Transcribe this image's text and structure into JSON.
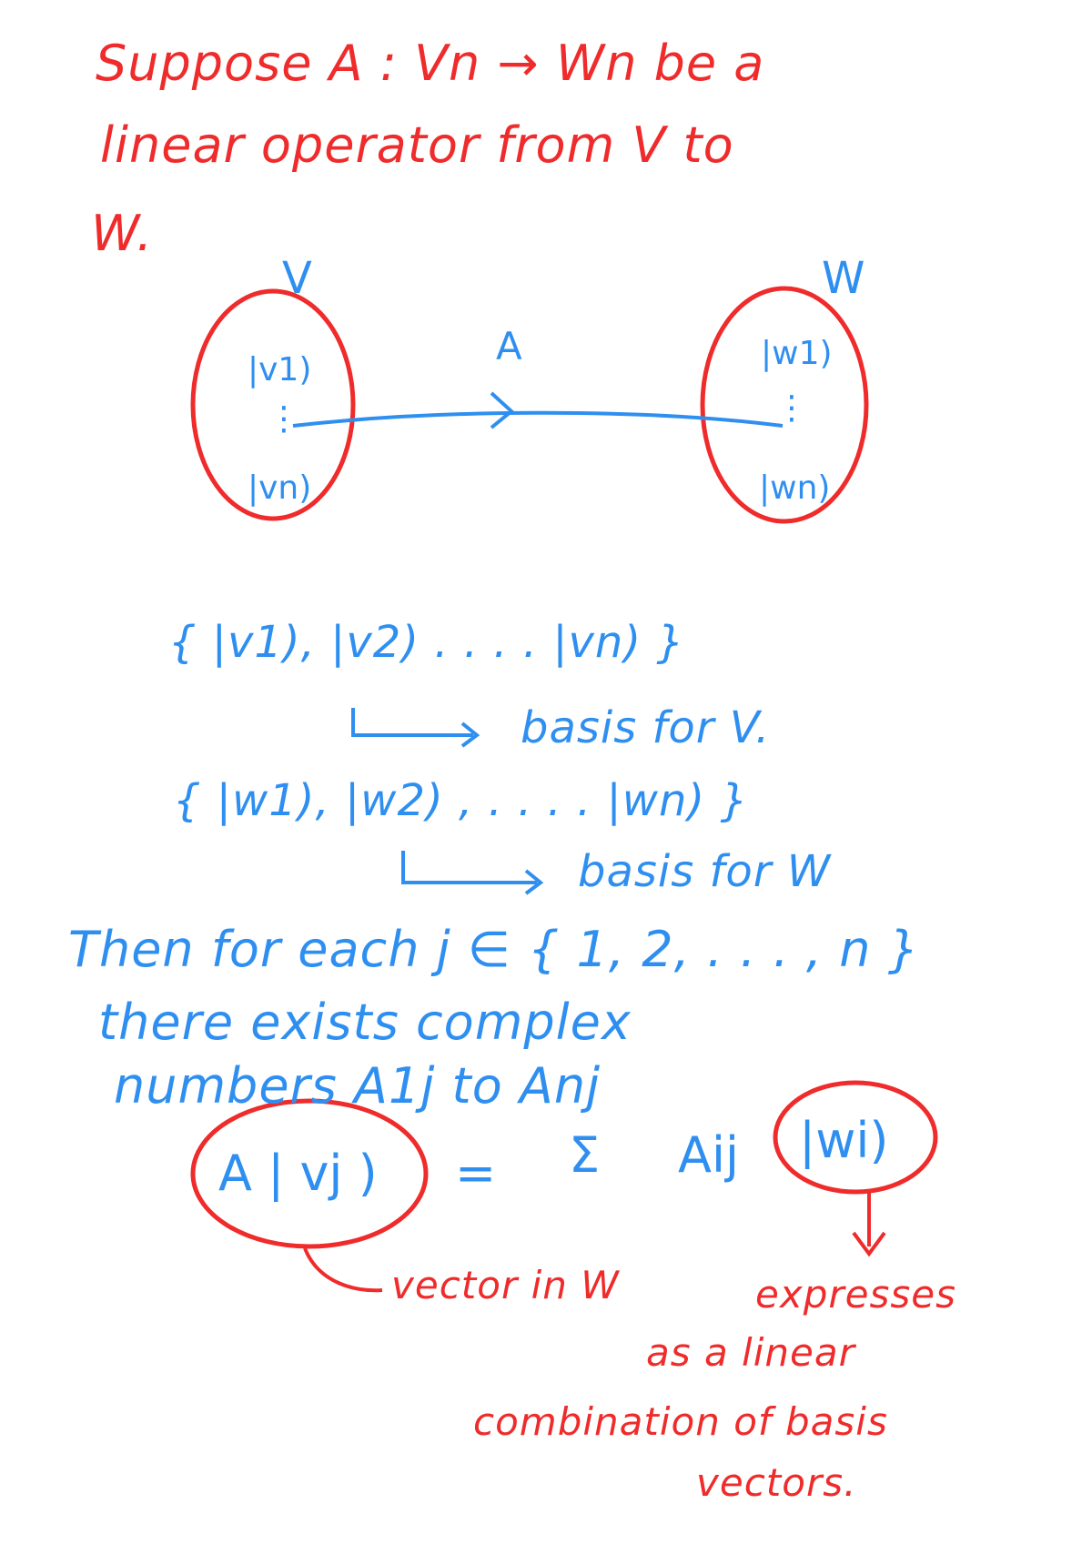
{
  "colors": {
    "red": "#ef2b2b",
    "blue": "#2f8ff0"
  },
  "intro": {
    "line1": "Suppose  A : Vn → Wn  be a",
    "line2": "linear operator from V to",
    "line3": "W."
  },
  "diagram": {
    "label_v": "V",
    "label_w": "W",
    "label_a": "A",
    "v_top": "|v1)",
    "v_dots": "⋮",
    "v_bottom": "|vn)",
    "w_top": "|w1)",
    "w_dots": "⋮",
    "w_bottom": "|wn)"
  },
  "basis_v": {
    "set": "{ |v1), |v2) . . . . |vn) }",
    "label": "basis for V."
  },
  "basis_w": {
    "set": "{ |w1), |w2) , . . . . |wn) }",
    "label": "basis for W"
  },
  "statement": {
    "line1": "Then for each  j ∈ { 1, 2, . . . , n }",
    "line2": "there exists complex",
    "line3": "numbers  A1j  to  Anj"
  },
  "equation": {
    "lhs": "A | vj )",
    "equals": "=",
    "sum": "Σ",
    "coef": "Aij",
    "ket": "|wi)"
  },
  "notes": {
    "vector_in_w": "vector in W",
    "expressed": "expresses",
    "as_a_linear": "as a linear",
    "combination": "combination of basis",
    "vectors": "vectors."
  }
}
